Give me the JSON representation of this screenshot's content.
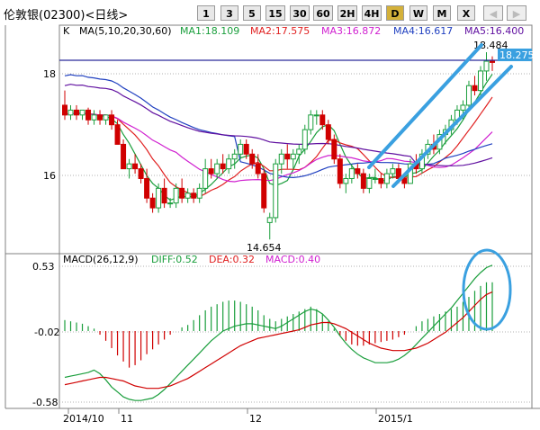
{
  "title": "伦敦银(02300)<日线>",
  "toolbar": {
    "buttons": [
      "1",
      "3",
      "5",
      "15",
      "30",
      "60",
      "2H",
      "4H",
      "D",
      "W",
      "M",
      "X"
    ],
    "active": "D",
    "back_icon": "left-arrow-icon",
    "forward_icon": "right-arrow-icon"
  },
  "price_panel": {
    "k_label": "K",
    "ma_header": "MA(5,10,20,30,60)",
    "ma": [
      {
        "label": "MA1:18.109",
        "color": "#1a9e3c"
      },
      {
        "label": "MA2:17.575",
        "color": "#e02020"
      },
      {
        "label": "MA3:16.872",
        "color": "#d020d0"
      },
      {
        "label": "MA4:16.617",
        "color": "#2040c0"
      },
      {
        "label": "MA5:16.400",
        "color": "#6010a0"
      }
    ],
    "y_ticks": [
      "18",
      "16"
    ],
    "high_label": "18.484",
    "low_label": "14.654",
    "current_price": "18.275"
  },
  "macd_panel": {
    "header": "MACD(26,12,9)",
    "diff": "DIFF:0.52",
    "dea": "DEA:0.32",
    "macd": "MACD:0.40",
    "y_ticks": [
      "0.53",
      "-0.02",
      "-0.58"
    ]
  },
  "x_axis": [
    "2014/10",
    "11",
    "12",
    "2015/1"
  ],
  "colors": {
    "up": "#1a9e3c",
    "down": "#d00000",
    "annotation": "#3aa0e0",
    "price_line": "#2a2a9a"
  },
  "chart_data": {
    "type": "candlestick",
    "ohlc": [
      [
        17.4,
        17.7,
        17.1,
        17.2
      ],
      [
        17.2,
        17.4,
        17.1,
        17.3
      ],
      [
        17.3,
        17.4,
        17.1,
        17.2
      ],
      [
        17.2,
        17.3,
        17.1,
        17.3
      ],
      [
        17.3,
        17.35,
        17.0,
        17.1
      ],
      [
        17.1,
        17.3,
        17.0,
        17.2
      ],
      [
        17.2,
        17.3,
        17.0,
        17.1
      ],
      [
        17.1,
        17.2,
        17.0,
        17.2
      ],
      [
        17.2,
        17.3,
        16.9,
        17.0
      ],
      [
        17.0,
        17.1,
        16.6,
        16.6
      ],
      [
        16.6,
        16.7,
        16.1,
        16.1
      ],
      [
        16.1,
        16.3,
        15.9,
        16.2
      ],
      [
        16.2,
        16.4,
        16.0,
        16.1
      ],
      [
        16.1,
        16.2,
        15.8,
        15.9
      ],
      [
        15.9,
        16.1,
        15.4,
        15.5
      ],
      [
        15.5,
        15.6,
        15.2,
        15.3
      ],
      [
        15.3,
        15.8,
        15.2,
        15.7
      ],
      [
        15.7,
        15.9,
        15.3,
        15.4
      ],
      [
        15.4,
        15.5,
        15.3,
        15.4
      ],
      [
        15.4,
        15.8,
        15.3,
        15.7
      ],
      [
        15.7,
        15.9,
        15.4,
        15.5
      ],
      [
        15.5,
        15.7,
        15.4,
        15.6
      ],
      [
        15.6,
        15.7,
        15.4,
        15.5
      ],
      [
        15.5,
        15.8,
        15.4,
        15.7
      ],
      [
        15.7,
        16.3,
        15.6,
        16.1
      ],
      [
        16.1,
        16.3,
        15.9,
        16.0
      ],
      [
        16.0,
        16.3,
        15.9,
        16.2
      ],
      [
        16.2,
        16.4,
        16.0,
        16.1
      ],
      [
        16.1,
        16.4,
        16.0,
        16.3
      ],
      [
        16.3,
        16.5,
        16.1,
        16.4
      ],
      [
        16.4,
        16.7,
        16.3,
        16.6
      ],
      [
        16.6,
        16.7,
        16.3,
        16.4
      ],
      [
        16.4,
        16.5,
        16.1,
        16.2
      ],
      [
        16.2,
        16.4,
        15.9,
        16.0
      ],
      [
        16.0,
        16.1,
        15.2,
        15.3
      ],
      [
        15.0,
        15.2,
        14.654,
        15.1
      ],
      [
        15.1,
        16.3,
        15.0,
        16.2
      ],
      [
        16.2,
        16.5,
        16.0,
        16.4
      ],
      [
        16.4,
        16.6,
        16.1,
        16.3
      ],
      [
        16.3,
        16.5,
        16.1,
        16.4
      ],
      [
        16.4,
        16.6,
        16.2,
        16.5
      ],
      [
        16.5,
        17.0,
        16.4,
        16.9
      ],
      [
        16.9,
        17.3,
        16.8,
        17.2
      ],
      [
        17.2,
        17.3,
        17.0,
        17.2
      ],
      [
        17.2,
        17.3,
        16.9,
        17.0
      ],
      [
        17.0,
        17.1,
        16.6,
        16.7
      ],
      [
        16.7,
        16.8,
        16.2,
        16.3
      ],
      [
        16.3,
        16.4,
        15.7,
        15.8
      ],
      [
        15.8,
        16.0,
        15.6,
        15.9
      ],
      [
        15.9,
        16.2,
        15.8,
        16.1
      ],
      [
        16.1,
        16.2,
        15.9,
        16.0
      ],
      [
        16.0,
        16.1,
        15.6,
        15.7
      ],
      [
        15.7,
        16.0,
        15.6,
        15.9
      ],
      [
        15.9,
        16.1,
        15.8,
        15.9
      ],
      [
        15.9,
        16.0,
        15.7,
        15.8
      ],
      [
        15.8,
        16.1,
        15.7,
        16.0
      ],
      [
        16.0,
        16.2,
        15.9,
        16.1
      ],
      [
        16.1,
        16.2,
        15.8,
        15.9
      ],
      [
        15.9,
        16.0,
        15.7,
        15.8
      ],
      [
        15.8,
        16.3,
        15.8,
        16.2
      ],
      [
        16.2,
        16.4,
        16.0,
        16.1
      ],
      [
        16.1,
        16.5,
        16.0,
        16.4
      ],
      [
        16.4,
        16.7,
        16.3,
        16.6
      ],
      [
        16.6,
        16.8,
        16.4,
        16.5
      ],
      [
        16.5,
        16.9,
        16.4,
        16.8
      ],
      [
        16.8,
        17.0,
        16.6,
        16.9
      ],
      [
        16.9,
        17.2,
        16.8,
        17.1
      ],
      [
        17.1,
        17.4,
        17.0,
        17.3
      ],
      [
        17.3,
        17.5,
        17.1,
        17.4
      ],
      [
        17.4,
        17.9,
        17.3,
        17.8
      ],
      [
        17.8,
        18.0,
        17.6,
        17.7
      ],
      [
        17.7,
        18.2,
        17.6,
        18.1
      ],
      [
        18.1,
        18.484,
        17.9,
        18.3
      ],
      [
        18.3,
        18.4,
        18.1,
        18.275
      ]
    ],
    "macd_hist": [
      0.09,
      0.08,
      0.07,
      0.06,
      0.04,
      0.02,
      -0.03,
      -0.08,
      -0.14,
      -0.2,
      -0.25,
      -0.3,
      -0.28,
      -0.24,
      -0.19,
      -0.15,
      -0.11,
      -0.07,
      -0.03,
      0.0,
      0.03,
      0.05,
      0.09,
      0.13,
      0.17,
      0.2,
      0.22,
      0.24,
      0.25,
      0.25,
      0.24,
      0.22,
      0.2,
      0.17,
      0.13,
      0.1,
      0.08,
      0.1,
      0.12,
      0.14,
      0.16,
      0.18,
      0.2,
      0.18,
      0.14,
      0.08,
      0.02,
      -0.04,
      -0.08,
      -0.11,
      -0.12,
      -0.12,
      -0.11,
      -0.1,
      -0.09,
      -0.08,
      -0.07,
      -0.05,
      -0.03,
      0.0,
      0.04,
      0.08,
      0.1,
      0.12,
      0.14,
      0.16,
      0.18,
      0.2,
      0.24,
      0.28,
      0.33,
      0.37,
      0.4,
      0.4
    ],
    "diff": [
      -0.38,
      -0.37,
      -0.36,
      -0.35,
      -0.34,
      -0.32,
      -0.35,
      -0.4,
      -0.46,
      -0.5,
      -0.54,
      -0.56,
      -0.57,
      -0.57,
      -0.56,
      -0.55,
      -0.52,
      -0.48,
      -0.43,
      -0.38,
      -0.33,
      -0.28,
      -0.23,
      -0.18,
      -0.13,
      -0.08,
      -0.04,
      0.0,
      0.02,
      0.04,
      0.05,
      0.06,
      0.06,
      0.05,
      0.04,
      0.03,
      0.02,
      0.04,
      0.07,
      0.1,
      0.13,
      0.16,
      0.18,
      0.17,
      0.14,
      0.09,
      0.03,
      -0.04,
      -0.1,
      -0.15,
      -0.19,
      -0.22,
      -0.24,
      -0.26,
      -0.26,
      -0.26,
      -0.25,
      -0.23,
      -0.2,
      -0.16,
      -0.11,
      -0.06,
      -0.01,
      0.04,
      0.09,
      0.14,
      0.19,
      0.25,
      0.31,
      0.37,
      0.43,
      0.48,
      0.52,
      0.54
    ],
    "dea": [
      -0.44,
      -0.43,
      -0.42,
      -0.41,
      -0.4,
      -0.39,
      -0.38,
      -0.38,
      -0.39,
      -0.4,
      -0.41,
      -0.43,
      -0.45,
      -0.46,
      -0.47,
      -0.47,
      -0.47,
      -0.46,
      -0.45,
      -0.43,
      -0.41,
      -0.39,
      -0.36,
      -0.33,
      -0.3,
      -0.27,
      -0.24,
      -0.21,
      -0.18,
      -0.15,
      -0.12,
      -0.1,
      -0.08,
      -0.06,
      -0.05,
      -0.04,
      -0.03,
      -0.02,
      -0.01,
      0.0,
      0.01,
      0.03,
      0.05,
      0.06,
      0.07,
      0.07,
      0.06,
      0.04,
      0.02,
      -0.01,
      -0.04,
      -0.07,
      -0.1,
      -0.12,
      -0.14,
      -0.15,
      -0.16,
      -0.16,
      -0.16,
      -0.15,
      -0.14,
      -0.12,
      -0.1,
      -0.07,
      -0.04,
      -0.01,
      0.03,
      0.07,
      0.11,
      0.16,
      0.21,
      0.26,
      0.3,
      0.32
    ],
    "y_range_price": [
      14.4,
      19.0
    ],
    "y_range_macd": [
      -0.62,
      0.62
    ]
  }
}
